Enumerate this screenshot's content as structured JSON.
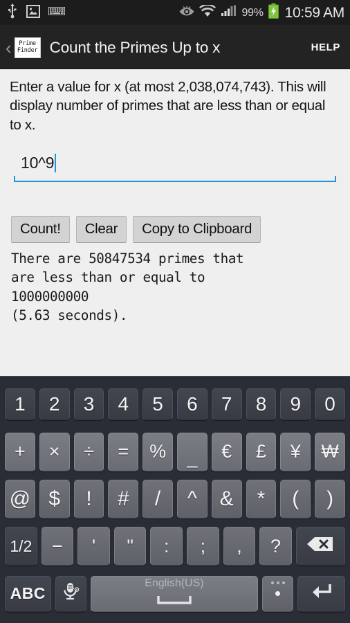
{
  "statusbar": {
    "icons_left": [
      "usb-icon",
      "screenshot-image-icon",
      "keyboard-icon"
    ],
    "icons_right": [
      "smart-stay-eye-icon",
      "wifi-icon",
      "cellular-signal-icon"
    ],
    "battery_percent": "99%",
    "battery_state": "charging",
    "clock": "10:59 AM"
  },
  "actionbar": {
    "back_label": "‹",
    "app_icon_line1": "Prime",
    "app_icon_line2": "Finder",
    "title": "Count the Primes Up to x",
    "help_label": "HELP"
  },
  "content": {
    "prompt": "Enter a value for x (at most 2,038,074,743). This will display number of primes that are less than or equal to x.",
    "max_value": "2,038,074,743",
    "input": {
      "value": "10^9",
      "placeholder": ""
    },
    "buttons": [
      {
        "label": "Count!",
        "name": "count-button"
      },
      {
        "label": "Clear",
        "name": "clear-button"
      },
      {
        "label": "Copy to Clipboard",
        "name": "copy-to-clipboard-button"
      }
    ],
    "result": "There are 50847534 primes that\nare less than or equal to\n1000000000\n(5.63 seconds).",
    "result_count": "50847534",
    "result_limit": "1000000000",
    "result_seconds": "5.63"
  },
  "keyboard": {
    "layout_label": "English(US)",
    "page_indicator": "1/2",
    "abc_label": "ABC",
    "rows": {
      "numbers": [
        "1",
        "2",
        "3",
        "4",
        "5",
        "6",
        "7",
        "8",
        "9",
        "0"
      ],
      "symbols1": [
        "+",
        "×",
        "÷",
        "=",
        "%",
        "_",
        "€",
        "£",
        "¥",
        "₩"
      ],
      "symbols2": [
        "@",
        "$",
        "!",
        "#",
        "/",
        "^",
        "&",
        "*",
        "(",
        ")"
      ],
      "symbols3": [
        "−",
        "'",
        "\"",
        ":",
        ";",
        ",",
        "?"
      ]
    },
    "colors": {
      "background": "#2a2d36",
      "key_dark": "#3e424b",
      "key_light": "#74777d"
    }
  }
}
